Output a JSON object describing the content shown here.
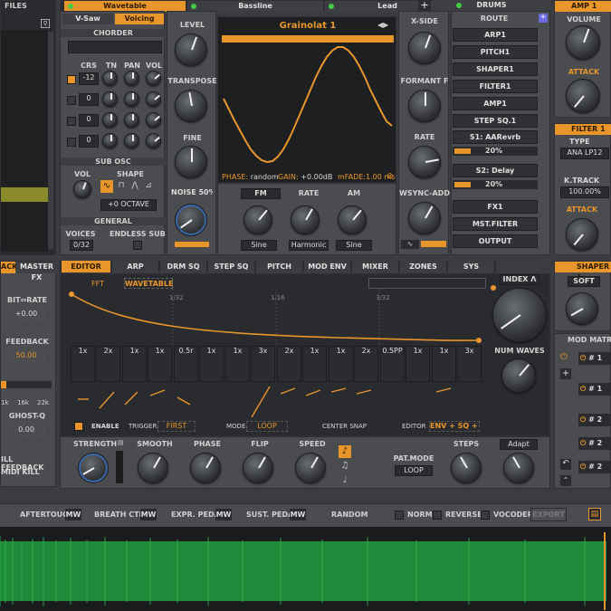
{
  "files": {
    "title": "FILES"
  },
  "osc_tabs": [
    {
      "label": "Wavetable"
    },
    {
      "label": "Bassline"
    },
    {
      "label": "Lead"
    }
  ],
  "drums": {
    "label": "DRUMS"
  },
  "amp1": {
    "title": "AMP 1",
    "volume": "VOLUME",
    "attack": "ATTACK"
  },
  "osc_subtabs": {
    "vsaw": "V-Saw",
    "voicing": "Voicing"
  },
  "chorder": {
    "title": "CHORDER",
    "cols": [
      "CRS",
      "TN",
      "PAN",
      "VOL"
    ],
    "rows": [
      "-12",
      "0",
      "0",
      "0"
    ]
  },
  "subosc": {
    "title": "SUB OSC",
    "vol": "VOL",
    "shape": "SHAPE",
    "octave": "+0 OCTAVE"
  },
  "general": {
    "title": "GENERAL",
    "voices": "VOICES",
    "voices_val": "0/32",
    "endless": "ENDLESS SUB"
  },
  "level": {
    "level": "LEVEL",
    "transpose": "TRANSPOSE",
    "fine": "FINE",
    "noise": "NOISE 50%"
  },
  "wave": {
    "name": "Grainolat 1",
    "phase": "PHASE:",
    "phase_val": "random",
    "gain": "GAIN:",
    "gain_val": "+0.00dB",
    "mfade": "mFADE:1.00 ms"
  },
  "right_osc": {
    "xside": "X-SIDE",
    "formant": "FORMANT F",
    "rate": "RATE",
    "wsync": "WSYNC-ADD"
  },
  "mod": {
    "fm": "FM",
    "rate": "RATE",
    "am": "AM",
    "sine1": "Sine",
    "harmonic": "Harmonic",
    "sine2": "Sine"
  },
  "route": {
    "title": "ROUTE",
    "items": [
      "ARP1",
      "PITCH1",
      "SHAPER1",
      "FILTER1",
      "AMP1",
      "STEP SQ.1"
    ],
    "s1": "S1: AARevrb",
    "s1_val": "20%",
    "s2": "S2: Delay",
    "s2_val": "20%",
    "fx1": "FX1",
    "mst": "MST.FILTER",
    "output": "OUTPUT"
  },
  "filter1": {
    "title": "FILTER 1",
    "type_lbl": "TYPE",
    "type_val": "ANA LP12",
    "ktrack": "K.TRACK",
    "ktrack_val": "100.00%",
    "attack": "ATTACK"
  },
  "left_fx": {
    "tab1": "ACK",
    "tab2": "MASTER FX",
    "bitrate": "BIT⇔RATE",
    "bitrate_val": "+0.00",
    "feedback": "FEEDBACK",
    "feedback_val": "50.00",
    "ticks": [
      "1k",
      "16k",
      "22k"
    ],
    "ghost": "GHOST-Q",
    "ghost_val": "0.00",
    "killfb": "ILL FEEDBACK",
    "midikill": "MIDI KILL"
  },
  "editor_tabs": [
    "EDITOR",
    "ARP",
    "DRM SQ",
    "STEP SQ",
    "PITCH",
    "MOD ENV",
    "MIXER",
    "ZONES",
    "SYS"
  ],
  "editor": {
    "fft": "FFT",
    "wavetable": "WAVETABLE",
    "marks": [
      "1/32",
      "1/16",
      "3/32"
    ],
    "cells": [
      "1x",
      "2x",
      "1x",
      "1x",
      "0.5r",
      "1x",
      "1x",
      "3x",
      "2x",
      "1x",
      "1x",
      "2x",
      "0.5PP",
      "1x",
      "1x",
      "3x"
    ],
    "enable": "ENABLE",
    "trigger": "TRIGGER:",
    "trigger_val": "FIRST",
    "mode": "MODE:",
    "mode_val": "LOOP",
    "snap": "CENTER SNAP",
    "editor_lbl": "EDITOR",
    "editor_val": "ENV + SQ + MOD"
  },
  "index": {
    "label": "INDEX Λ",
    "numwaves": "NUM WAVES"
  },
  "controls": {
    "strength": "STRENGTH",
    "smooth": "SMOOTH",
    "phase": "PHASE",
    "flip": "FLIP",
    "speed": "SPEED",
    "patmode": "PAT.MODE",
    "patmode_val": "LOOP",
    "steps": "STEPS",
    "adapt": "Adapt"
  },
  "shaper1": {
    "title": "SHAPER 1",
    "soft": "SOFT"
  },
  "modmatrix": {
    "title": "MOD MATRIX",
    "slots": [
      "# 1",
      "# 1",
      "# 2",
      "# 2",
      "# 2"
    ]
  },
  "bottom": {
    "aftertouch": "AFTERTOUCH",
    "breath": "BREATH CTRL.",
    "expr": "EXPR. PEDAL",
    "sust": "SUST. PEDAL",
    "random": "RANDOM",
    "mw": "MW",
    "norm": "NORM",
    "reverse": "REVERSE",
    "vocoder": "VOCODER",
    "export": "EXPORT"
  },
  "colors": {
    "accent": "#e8962c",
    "waveform": "#2aa04a",
    "bg": "#3a3c3f"
  }
}
